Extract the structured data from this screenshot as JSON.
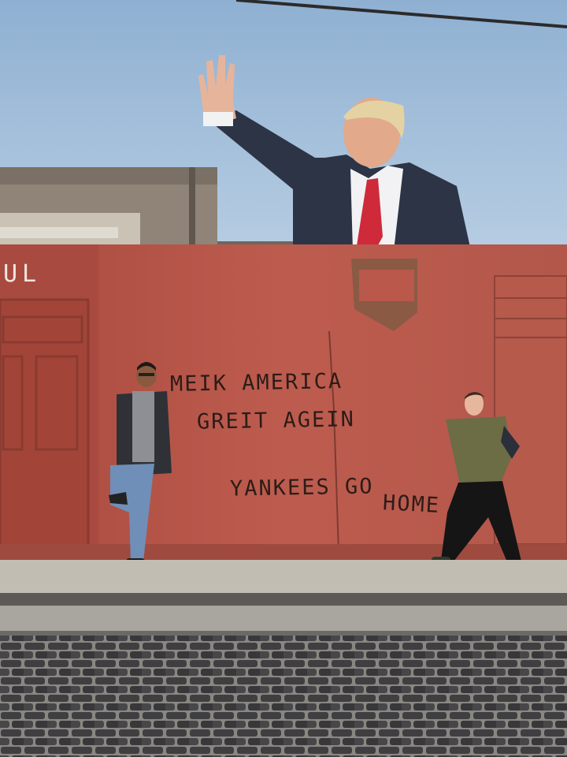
{
  "graffiti": {
    "line1": "MEIK AMERICA",
    "line2": "GREIT AGEIN",
    "line3": "YANKEES GO",
    "line3_end": "HOME"
  },
  "building_sign_fragment": "UL",
  "colors": {
    "sky": "#a9c4de",
    "wall": "#b8574a",
    "suit": "#2c3445",
    "tie": "#cf2a3a",
    "cobblestone": "#4b4b4e"
  }
}
